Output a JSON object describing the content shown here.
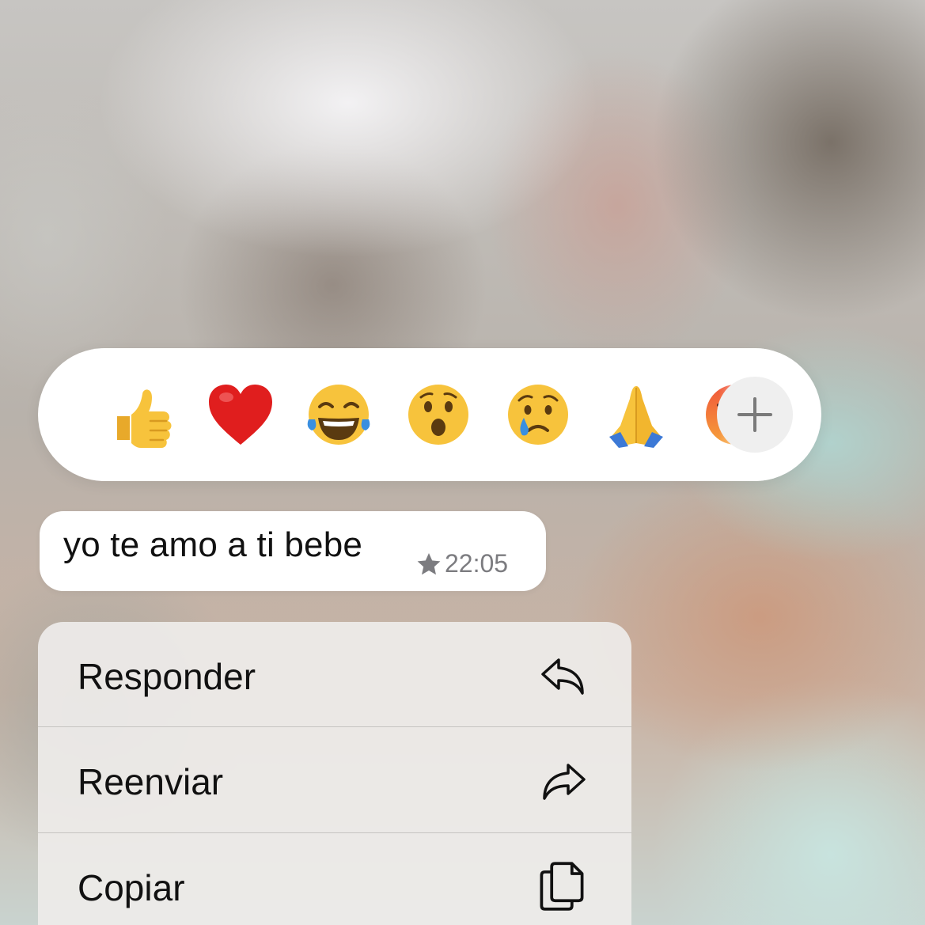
{
  "reactions": {
    "emojis": [
      {
        "name": "thumbs-up",
        "char": "👍"
      },
      {
        "name": "red-heart",
        "char": "❤️"
      },
      {
        "name": "tears-of-joy",
        "char": "😂"
      },
      {
        "name": "surprised",
        "char": "😮"
      },
      {
        "name": "crying",
        "char": "😢"
      },
      {
        "name": "folded-hands",
        "char": "🙏"
      },
      {
        "name": "angry",
        "char": "😡"
      }
    ],
    "more_icon": "plus-icon"
  },
  "message": {
    "text": "yo te amo a ti bebe",
    "starred_icon": "star-icon",
    "time": "22:05"
  },
  "menu": {
    "items": [
      {
        "label": "Responder",
        "icon": "reply-icon"
      },
      {
        "label": "Reenviar",
        "icon": "forward-icon"
      },
      {
        "label": "Copiar",
        "icon": "copy-icon"
      }
    ]
  },
  "colors": {
    "emoji_yellow": "#F7C33C",
    "heart_red": "#E01E1E",
    "tear_blue": "#3A8FE0",
    "meta_gray": "#7C7C80"
  }
}
